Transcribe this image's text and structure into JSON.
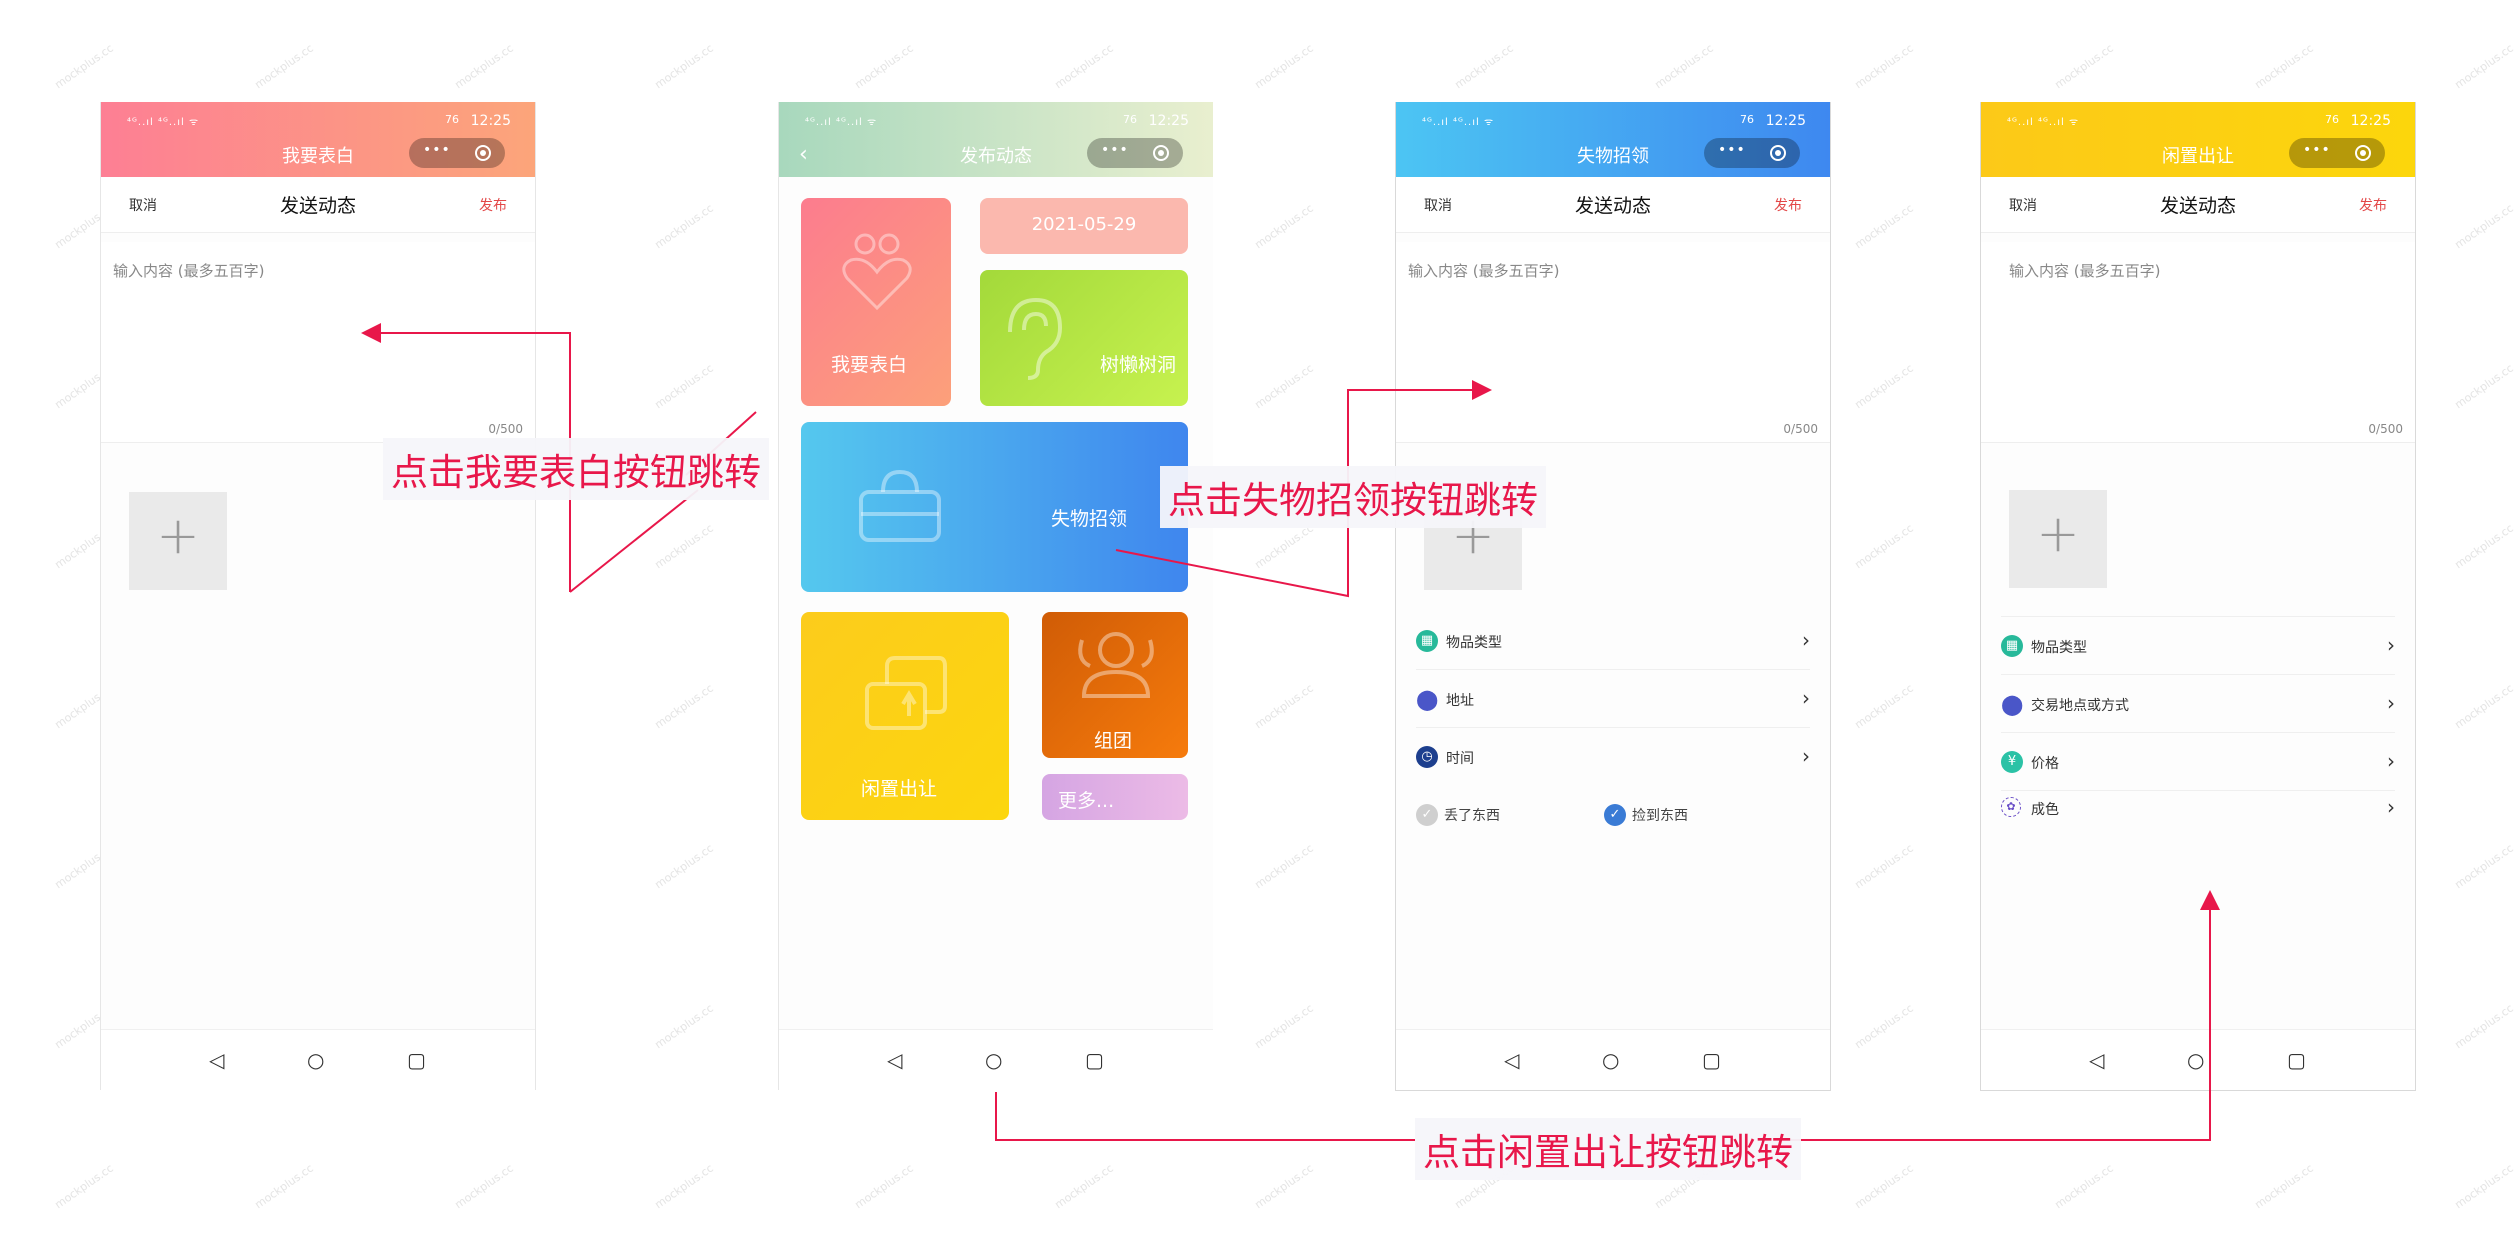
{
  "status_bar": {
    "signal": "⁴ᴳ..ıl ⁴ᴳ..ıl ᯤ",
    "time": "12:25",
    "battery": "76"
  },
  "phone1": {
    "title": "我要表白",
    "nav": {
      "cancel": "取消",
      "title": "发送动态",
      "publish": "发布"
    },
    "input_placeholder": "输入内容 (最多五百字)",
    "counter": "0/500",
    "add_symbol": "+"
  },
  "phone2": {
    "title": "发布动态",
    "tiles": {
      "confession": "我要表白",
      "date": "2021-05-29",
      "tree_hole": "树懒树洞",
      "lost_found": "失物招领",
      "idle": "闲置出让",
      "group": "组团",
      "more": "更多..."
    }
  },
  "phone3": {
    "title": "失物招领",
    "nav": {
      "cancel": "取消",
      "title": "发送动态",
      "publish": "发布"
    },
    "input_placeholder": "输入内容 (最多五百字)",
    "counter": "0/500",
    "add_symbol": "+",
    "options": [
      "物品类型",
      "地址",
      "时间"
    ],
    "radio_lost": "丢了东西",
    "radio_found": "捡到东西"
  },
  "phone4": {
    "title": "闲置出让",
    "nav": {
      "cancel": "取消",
      "title": "发送动态",
      "publish": "发布"
    },
    "input_placeholder": "输入内容 (最多五百字)",
    "counter": "0/500",
    "add_symbol": "+",
    "options": [
      "物品类型",
      "交易地点或方式",
      "价格",
      "成色"
    ]
  },
  "system_nav": {
    "back": "◁",
    "home": "○",
    "recent": "▢"
  },
  "annotations": {
    "confession": "点击我要表白按钮跳转",
    "lost_found": "点击失物招领按钮跳转",
    "idle": "点击闲置出让按钮跳转"
  },
  "watermark": "mockplus.cc",
  "colors": {
    "phone1_header": "#fc8a8f",
    "phone3_header": "#4f9df5",
    "phone4_header": "#fccf1c",
    "annotation": "#e8174a",
    "publish": "#e34848"
  },
  "icons": {
    "option_type": "grid-icon",
    "option_address": "location-pin-icon",
    "option_time": "clock-icon",
    "option_price": "yen-icon",
    "option_condition": "badge-icon",
    "radio_checked": "check-icon"
  }
}
